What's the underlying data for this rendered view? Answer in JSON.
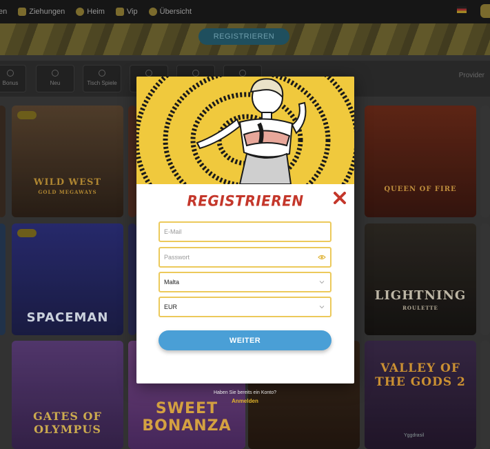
{
  "topnav": {
    "items": [
      {
        "label": "en",
        "icon": "none"
      },
      {
        "label": "Ziehungen",
        "icon": "ticket-icon"
      },
      {
        "label": "Heim",
        "icon": "coin-icon"
      },
      {
        "label": "Vip",
        "icon": "crown-icon"
      },
      {
        "label": "Übersicht",
        "icon": "coin-icon"
      }
    ]
  },
  "banner": {
    "register_label": "REGISTRIEREN"
  },
  "categories": [
    "Bonus",
    "Neu",
    "Tisch Spiele",
    "",
    "",
    ""
  ],
  "background_search": "Provider",
  "game_tiles": [
    {
      "title": "WILD WEST",
      "subtitle": "GOLD MEGAWAYS"
    },
    {
      "title": "QUEEN OF FIRE",
      "subtitle": ""
    },
    {
      "title": "SPACEMAN",
      "subtitle": ""
    },
    {
      "title": "LIGHTNING",
      "subtitle": "ROULETTE"
    },
    {
      "title": "GATES OF OLYMPUS",
      "subtitle": ""
    },
    {
      "title": "SWEET BONANZA",
      "subtitle": ""
    },
    {
      "title": "VALLEY OF THE GODS 2",
      "subtitle": ""
    }
  ],
  "modal": {
    "title": "REGISTRIEREN",
    "email": {
      "value": "",
      "placeholder": "E-Mail"
    },
    "password": {
      "value": "",
      "placeholder": "Passwort"
    },
    "country": {
      "value": "Malta"
    },
    "currency": {
      "value": "EUR"
    },
    "submit_label": "WEITER"
  },
  "login": {
    "question": "Haben Sie bereits ein Konto?",
    "link": "Anmelden"
  },
  "footer_note": "Yggdrasil",
  "colors": {
    "accent_blue": "#4a9fd6",
    "title_red": "#c4372b",
    "field_border": "#ecc95a",
    "art_yellow": "#f0c93d",
    "link_gold": "#e3b52b"
  }
}
